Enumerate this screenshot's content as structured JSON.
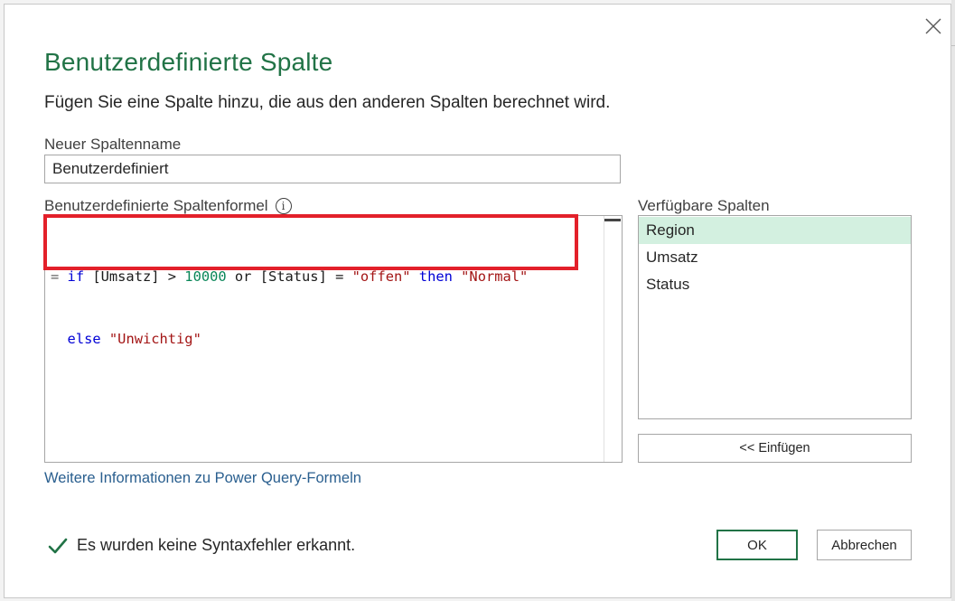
{
  "dialog": {
    "title": "Benutzerdefinierte Spalte",
    "subtitle": "Fügen Sie eine Spalte hinzu, die aus den anderen Spalten berechnet wird."
  },
  "new_column": {
    "label": "Neuer Spaltenname",
    "value": "Benutzerdefiniert"
  },
  "formula": {
    "label": "Benutzerdefinierte Spaltenformel",
    "line1": [
      {
        "t": "= ",
        "c": "op"
      },
      {
        "t": "if",
        "c": "kw"
      },
      {
        "t": " [Umsatz] > ",
        "c": "pl"
      },
      {
        "t": "10000",
        "c": "num"
      },
      {
        "t": " or [Status] = ",
        "c": "pl"
      },
      {
        "t": "\"offen\"",
        "c": "str"
      },
      {
        "t": " ",
        "c": "pl"
      },
      {
        "t": "then",
        "c": "kw"
      },
      {
        "t": " ",
        "c": "pl"
      },
      {
        "t": "\"Normal\"",
        "c": "str"
      }
    ],
    "line2": [
      {
        "t": "  ",
        "c": "pl"
      },
      {
        "t": "else",
        "c": "kw"
      },
      {
        "t": " ",
        "c": "pl"
      },
      {
        "t": "\"Unwichtig\"",
        "c": "str"
      }
    ],
    "highlight_color": "#e3202a"
  },
  "available_columns": {
    "label": "Verfügbare Spalten",
    "items": [
      "Region",
      "Umsatz",
      "Status"
    ],
    "selected_index": 0,
    "insert_label": "<< Einfügen"
  },
  "help_link": "Weitere Informationen zu Power Query-Formeln",
  "status": {
    "text": "Es wurden keine Syntaxfehler erkannt.",
    "icon": "check-icon"
  },
  "buttons": {
    "ok": "OK",
    "cancel": "Abbrechen"
  },
  "colors": {
    "accent": "#217346",
    "link": "#2a5f8f",
    "selection": "#d3f0e0"
  }
}
